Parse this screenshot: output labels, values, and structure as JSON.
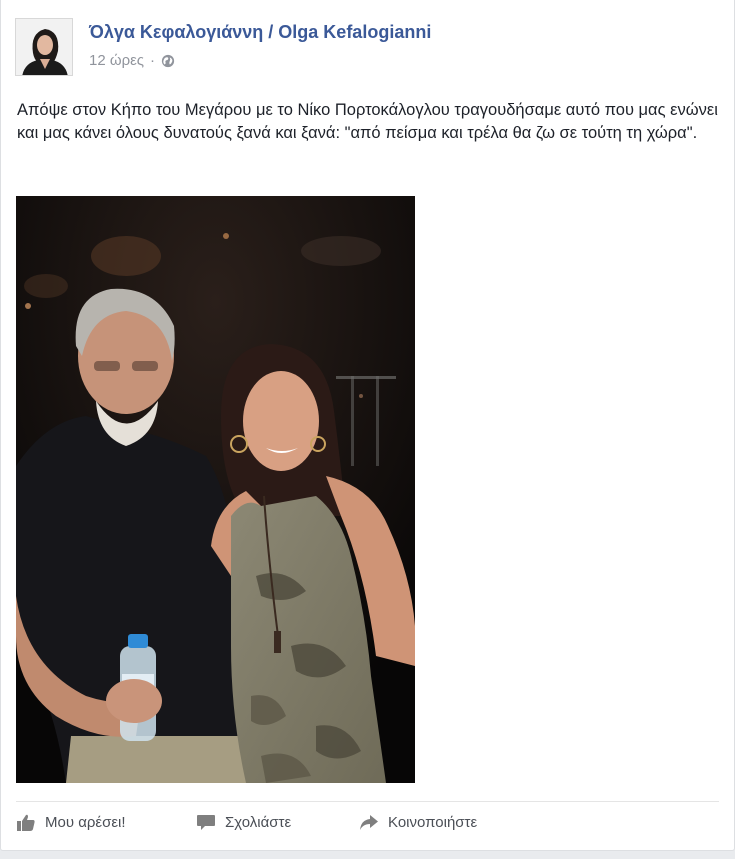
{
  "post": {
    "author": "Όλγα Κεφαλογιάννη / Olga Kefalogianni",
    "timestamp": "12 ώρες",
    "separator": "·",
    "privacy_icon": "globe-icon",
    "text": "Απόψε στον Κήπο του Μεγάρου με το Νίκο Πορτοκάλογλου τραγουδήσαμε αυτό που μας ενώνει και μας κάνει όλους δυνατούς ξανά και ξανά: \"από πείσμα και τρέλα θα ζω σε τούτη τη χώρα\"."
  },
  "actions": {
    "like": {
      "label": "Μου αρέσει!",
      "icon": "thumbs-up-icon"
    },
    "comment": {
      "label": "Σχολιάστε",
      "icon": "comment-icon"
    },
    "share": {
      "label": "Κοινοποιήστε",
      "icon": "share-icon"
    }
  },
  "colors": {
    "author_link": "#3b5998",
    "meta_text": "#90949c",
    "action_text": "#4b4f56",
    "body_text": "#1d2129"
  }
}
